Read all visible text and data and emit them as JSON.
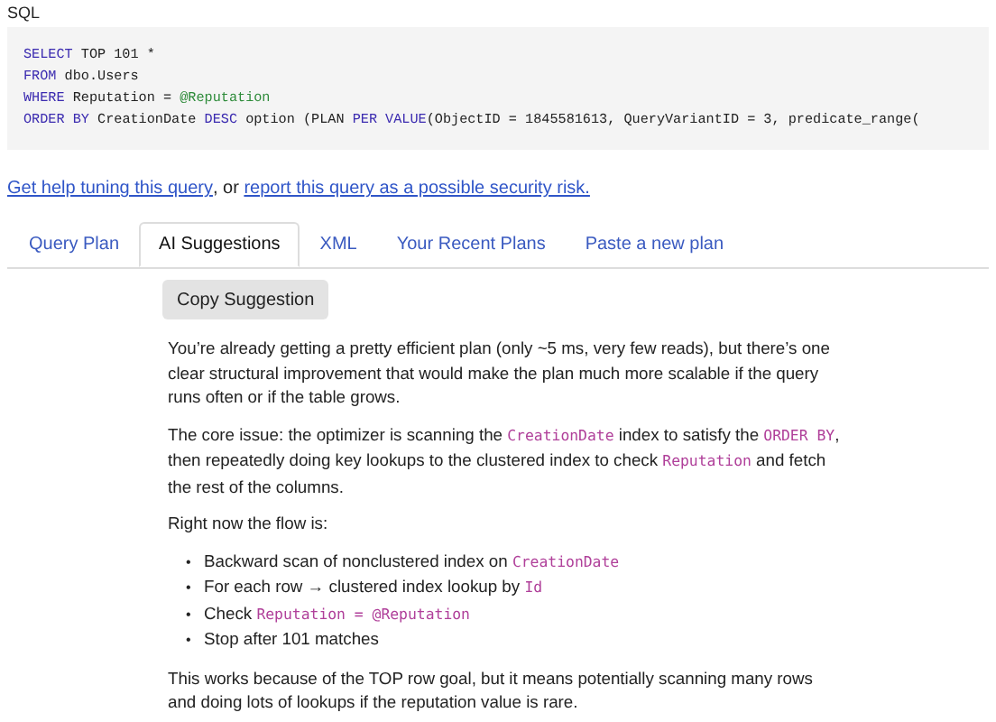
{
  "sql_label": "SQL",
  "sql_lines": [
    [
      {
        "kind": "keyword",
        "text": "SELECT"
      },
      {
        "kind": "plain",
        "text": " TOP 101 *"
      }
    ],
    [
      {
        "kind": "keyword",
        "text": "FROM"
      },
      {
        "kind": "plain",
        "text": " dbo.Users"
      }
    ],
    [
      {
        "kind": "keyword",
        "text": "WHERE"
      },
      {
        "kind": "plain",
        "text": " Reputation = "
      },
      {
        "kind": "variable",
        "text": "@Reputation"
      }
    ],
    [
      {
        "kind": "keyword",
        "text": "ORDER BY"
      },
      {
        "kind": "plain",
        "text": " CreationDate "
      },
      {
        "kind": "keyword",
        "text": "DESC"
      },
      {
        "kind": "plain",
        "text": " option (PLAN "
      },
      {
        "kind": "keyword",
        "text": "PER"
      },
      {
        "kind": "space"
      },
      {
        "kind": "keyword",
        "text": "VALUE"
      },
      {
        "kind": "plain",
        "text": "(ObjectID = 1845581613, QueryVariantID = 3, predicate_range("
      }
    ]
  ],
  "help_line": [
    {
      "kind": "link",
      "text": "Get help tuning this query"
    },
    {
      "kind": "text",
      "text": ", or "
    },
    {
      "kind": "link",
      "text": "report this query as a possible security risk."
    }
  ],
  "tabs": [
    {
      "label": "Query Plan",
      "selected": false
    },
    {
      "label": "AI Suggestions",
      "selected": true
    },
    {
      "label": "XML",
      "selected": false
    },
    {
      "label": "Your Recent Plans",
      "selected": false
    },
    {
      "label": "Paste a new plan",
      "selected": false
    }
  ],
  "copy_button": "Copy Suggestion",
  "content": [
    {
      "kind": "paragraph",
      "parts": [
        {
          "kind": "text",
          "text": "You’re already getting a pretty efficient plan (only ~5 ms, very few reads), but there’s one clear structural improvement that would make the plan much more scalable if the query runs often or if the table grows."
        }
      ]
    },
    {
      "kind": "paragraph",
      "parts": [
        {
          "kind": "text",
          "text": "The core issue: the optimizer is scanning the "
        },
        {
          "kind": "code",
          "text": "CreationDate"
        },
        {
          "kind": "text",
          "text": " index to satisfy the "
        },
        {
          "kind": "code",
          "text": "ORDER BY"
        },
        {
          "kind": "text",
          "text": ", then repeatedly doing key lookups to the clustered index to check "
        },
        {
          "kind": "code",
          "text": "Reputation"
        },
        {
          "kind": "text",
          "text": " and fetch the rest of the columns."
        }
      ]
    },
    {
      "kind": "paragraph",
      "parts": [
        {
          "kind": "text",
          "text": "Right now the flow is:"
        }
      ]
    },
    {
      "kind": "list",
      "bullet": "•",
      "items": [
        [
          {
            "kind": "text",
            "text": "Backward scan of nonclustered index on "
          },
          {
            "kind": "code",
            "text": "CreationDate"
          }
        ],
        [
          {
            "kind": "text",
            "text": "For each row → clustered index lookup by "
          },
          {
            "kind": "code",
            "text": "Id"
          }
        ],
        [
          {
            "kind": "text",
            "text": "Check "
          },
          {
            "kind": "code",
            "text": "Reputation = @Reputation"
          }
        ],
        [
          {
            "kind": "text",
            "text": "Stop after 101 matches"
          }
        ]
      ]
    },
    {
      "kind": "paragraph",
      "parts": [
        {
          "kind": "text",
          "text": "This works because of the TOP row goal, but it means potentially scanning many rows and doing lots of lookups if the reputation value is rare."
        }
      ]
    }
  ]
}
